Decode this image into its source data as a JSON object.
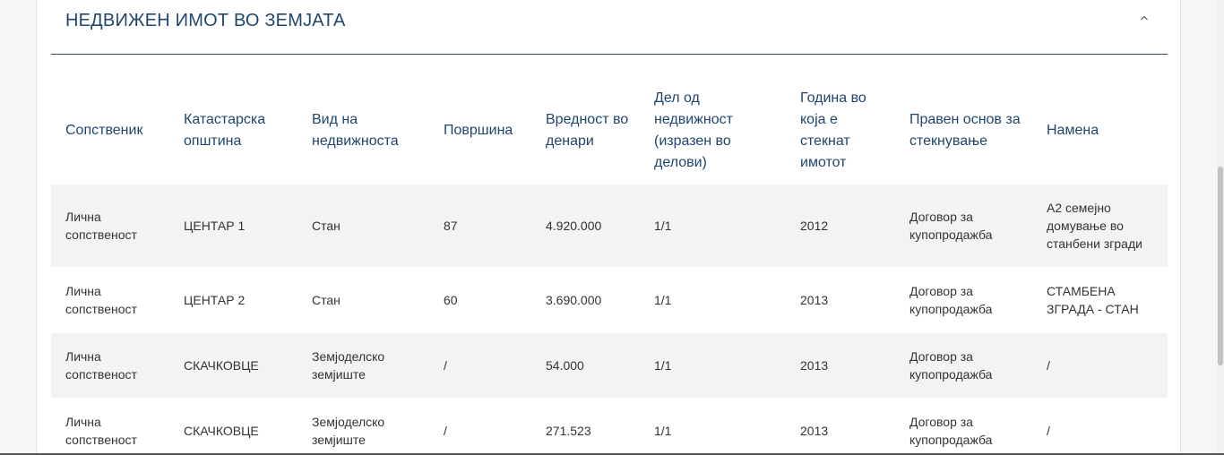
{
  "section": {
    "title": "НЕДВИЖЕН ИМОТ ВО ЗЕМЈАТА"
  },
  "table": {
    "headers": [
      "Сопственик",
      "Катастарска општина",
      "Вид на недвижноста",
      "Површина",
      "Вредност во денари",
      "Дел од недвижност (изразен во делови)",
      "Година во која е стекнат имотот",
      "Правен основ за стекнување",
      "Намена"
    ],
    "rows": [
      [
        "Лична сопственост",
        "ЦЕНТАР 1",
        "Стан",
        "87",
        "4.920.000",
        "1/1",
        "2012",
        "Договор за купопродажба",
        "А2 семејно домување во станбени згради"
      ],
      [
        "Лична сопственост",
        "ЦЕНТАР 2",
        "Стан",
        "60",
        "3.690.000",
        "1/1",
        "2013",
        "Договор за купопродажба",
        "СТАМБЕНА ЗГРАДА - СТАН"
      ],
      [
        "Лична сопственост",
        "СКАЧКОВЦЕ",
        "Земјоделско земјиште",
        "/",
        "54.000",
        "1/1",
        "2013",
        "Договор за купопродажба",
        "/"
      ],
      [
        "Лична сопственост",
        "СКАЧКОВЦЕ",
        "Земјоделско земјиште",
        "/",
        "271.523",
        "1/1",
        "2013",
        "Договор за купопродажба",
        "/"
      ]
    ]
  },
  "icons": {
    "collapse": "chevron-up-icon"
  },
  "colors": {
    "title": "#21466f",
    "header_text": "#1f456d",
    "divider": "#2c4b6b",
    "row_stripe": "#f3f3f3",
    "body_text": "#333333"
  }
}
